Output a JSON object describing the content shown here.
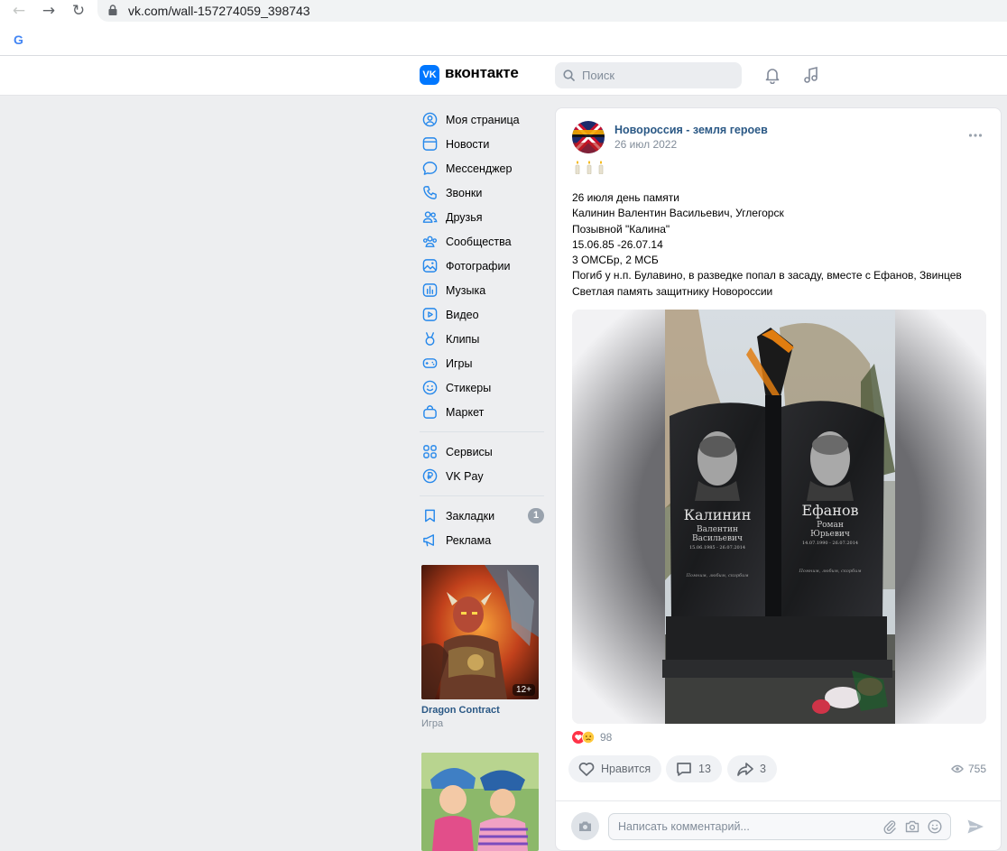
{
  "browser": {
    "url": "vk.com/wall-157274059_398743",
    "google_letter": "G"
  },
  "header": {
    "logo_mark": "VK",
    "logo_text": "вконтакте",
    "search_placeholder": "Поиск"
  },
  "sidebar": {
    "items": [
      {
        "label": "Моя страница",
        "icon": "user-icon"
      },
      {
        "label": "Новости",
        "icon": "news-icon"
      },
      {
        "label": "Мессенджер",
        "icon": "message-icon"
      },
      {
        "label": "Звонки",
        "icon": "phone-icon"
      },
      {
        "label": "Друзья",
        "icon": "friends-icon"
      },
      {
        "label": "Сообщества",
        "icon": "communities-icon"
      },
      {
        "label": "Фотографии",
        "icon": "photo-icon"
      },
      {
        "label": "Музыка",
        "icon": "music-icon"
      },
      {
        "label": "Видео",
        "icon": "video-icon"
      },
      {
        "label": "Клипы",
        "icon": "clips-icon"
      },
      {
        "label": "Игры",
        "icon": "games-icon"
      },
      {
        "label": "Стикеры",
        "icon": "sticker-icon"
      },
      {
        "label": "Маркет",
        "icon": "market-icon"
      }
    ],
    "services": [
      {
        "label": "Сервисы",
        "icon": "services-icon"
      },
      {
        "label": "VK Pay",
        "icon": "vkpay-icon"
      }
    ],
    "extra": [
      {
        "label": "Закладки",
        "icon": "bookmark-icon",
        "badge": "1"
      },
      {
        "label": "Реклама",
        "icon": "ads-icon"
      }
    ],
    "ad": {
      "title": "Dragon Contract",
      "subtitle": "Игра",
      "age": "12+"
    }
  },
  "post": {
    "author": "Новороссия - земля героев",
    "date": "26 июл 2022",
    "lines": [
      "26 июля день памяти",
      "Калинин Валентин Васильевич, Углегорск",
      "Позывной \"Калина\"",
      "15.06.85 -26.07.14",
      "3 ОМСБр, 2 МСБ",
      "Погиб у н.п. Булавино, в разведке попал в засаду, вместе с Ефанов, Звинцев",
      "Светлая память защитнику Новороссии"
    ],
    "photo": {
      "left_name": "Калинин",
      "left_given": "Валентин",
      "left_patronymic": "Васильевич",
      "left_dates": "15.06.1985 - 26.07.2014",
      "right_name": "Ефанов",
      "right_given": "Роман",
      "right_patronymic": "Юрьевич",
      "right_dates": "14.07.1990 - 26.07.2014",
      "left_epitaph": "Помним, любим, скорбим",
      "right_epitaph": "Помним, любим, скорбим"
    },
    "reactions_count": "98",
    "like_label": "Нравится",
    "comments_count": "13",
    "shares_count": "3",
    "views_count": "755",
    "comment_placeholder": "Написать комментарий..."
  },
  "colors": {
    "vk_blue": "#0077ff",
    "link": "#2a5885",
    "background": "#edeef0",
    "icon_blue": "#2688eb"
  }
}
